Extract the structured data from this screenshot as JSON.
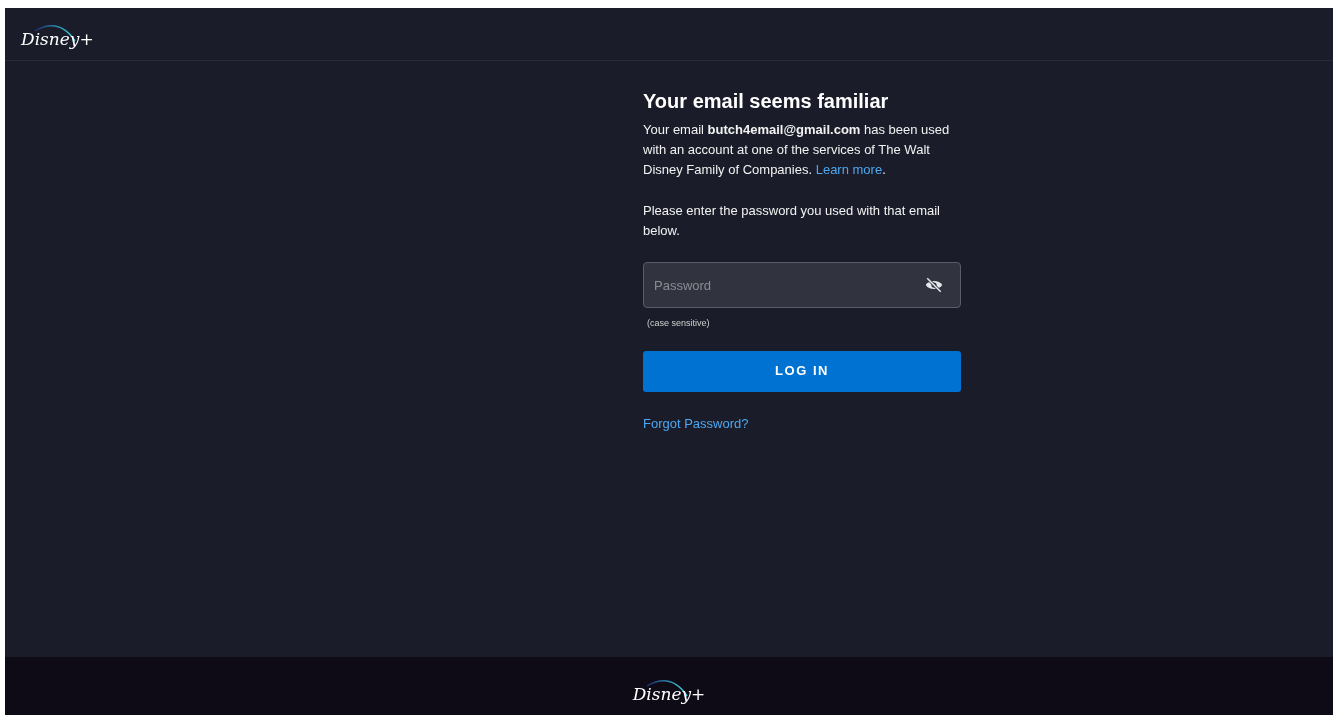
{
  "header": {
    "logo": "Disney+"
  },
  "title": "Your email seems familiar",
  "intro": {
    "text": "Your email **butch4email@gmail.com** has been used with an account at one of the services of The Walt Disney Family of Companies. ",
    "link": "Learn more",
    "after": "."
  },
  "instruction": "Please enter the password you used with that email below.",
  "password_field": {
    "placeholder": "Password",
    "hint": "(case sensitive)",
    "visible": false
  },
  "login_button": "LOG IN",
  "forgot_link": "Forgot Password?",
  "footer": {
    "logo": "Disney+"
  }
}
